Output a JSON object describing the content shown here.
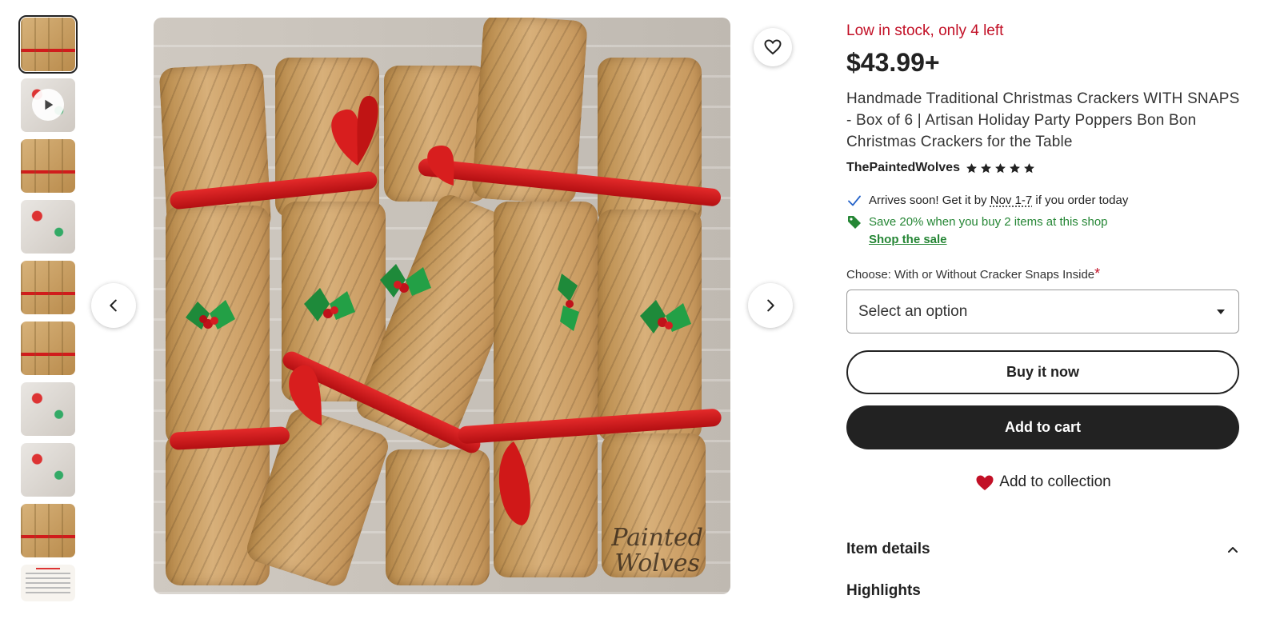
{
  "listing": {
    "stock_text": "Low in stock, only 4 left",
    "price": "$43.99+",
    "title": "Handmade Traditional Christmas Crackers WITH SNAPS - Box of 6 | Artisan Holiday Party Poppers Bon Bon Christmas Crackers for the Table",
    "shop_name": "ThePaintedWolves",
    "rating_stars": 5
  },
  "perks": {
    "arrival_prefix": "Arrives soon! Get it by ",
    "arrival_date": "Nov 1-7",
    "arrival_suffix": " if you order today",
    "sale_text": "Save 20% when you buy 2 items at this shop",
    "sale_link": "Shop the sale"
  },
  "variation": {
    "label": "Choose: With or Without Cracker Snaps Inside",
    "required_mark": "*",
    "placeholder": "Select an option"
  },
  "actions": {
    "buy_now": "Buy it now",
    "add_to_cart": "Add to cart",
    "add_to_collection": "Add to collection"
  },
  "sections": {
    "item_details": "Item details",
    "highlights": "Highlights"
  },
  "image": {
    "watermark_line1": "Painted",
    "watermark_line2": "Wolves"
  },
  "colors": {
    "stock_red": "#c21026",
    "sale_green": "#258635",
    "dark_button": "#222222"
  },
  "icons": {
    "favorite": "heart-outline-icon",
    "prev": "chevron-left-icon",
    "next": "chevron-right-icon",
    "video": "play-icon",
    "check": "checkmark-icon",
    "tag": "price-tag-icon",
    "collection": "heart-filled-icon",
    "dropdown": "caret-down-icon",
    "collapse": "chevron-up-icon"
  }
}
